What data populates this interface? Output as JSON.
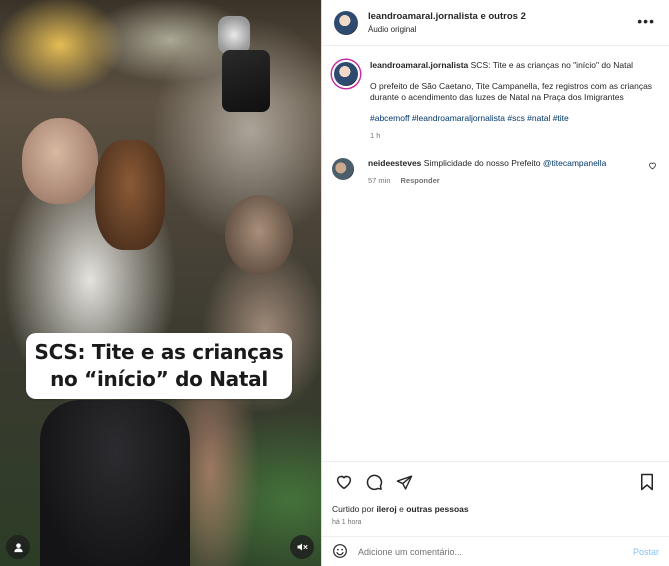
{
  "colors": {
    "text": "#262626",
    "muted": "#737373",
    "link": "#00376b",
    "post_button": "#85c3f7",
    "story_ring": "#c32aa3"
  },
  "header": {
    "avatar_icon": "profile-avatar",
    "username": "leandroamaral.jornalista e outros 2",
    "subtitle": "Áudio original",
    "more_icon": "more-horizontal-icon"
  },
  "video": {
    "overlay_line1": "SCS: Tite e as crianças",
    "overlay_line2": "no “início” do Natal",
    "user_icon": "tagged-user-icon",
    "mute_icon": "muted-speaker-icon"
  },
  "caption": {
    "username": "leandroamaral.jornalista",
    "title": "SCS: Tite e as crianças no \"início\" do Natal",
    "body": "O prefeito de São Caetano, Tite Campanella, fez registros com as crianças durante o acendimento das luzes de Natal na Praça dos Imigrantes",
    "hashtags": "#abcemoff #leandroamaraljornalista #scs #natal #tite",
    "time_ago": "1 h"
  },
  "comment": {
    "username": "neideesteves",
    "text": "Simplicidade do nosso Prefeito",
    "mention": "@titecampanella",
    "time_ago": "57 min",
    "reply_label": "Responder",
    "like_icon": "heart-small-icon"
  },
  "actions": {
    "like_icon": "heart-icon",
    "comment_icon": "comment-icon",
    "share_icon": "share-icon",
    "save_icon": "bookmark-icon",
    "likes_prefix": "Curtido por",
    "likes_user": "ileroj",
    "likes_conjunction": "e",
    "likes_rest": "outras pessoas",
    "posted_ago": "há 1 hora"
  },
  "add_comment": {
    "emoji_icon": "emoji-icon",
    "placeholder": "Adicione um comentário...",
    "post_label": "Postar"
  }
}
